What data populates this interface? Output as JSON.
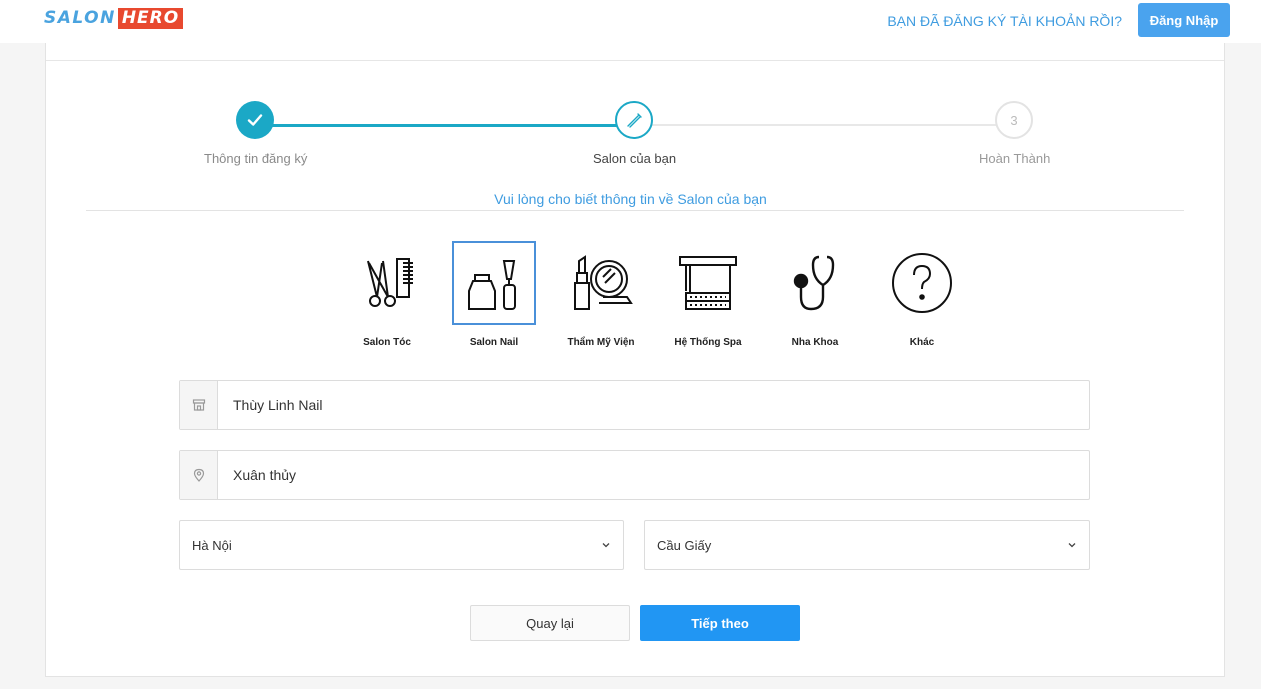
{
  "header": {
    "logo_part1": "SALON",
    "logo_part2": "HERO",
    "already_registered": "BẠN ĐÃ ĐĂNG KÝ TÀI KHOẢN RỒI?",
    "login_label": "Đăng Nhập"
  },
  "steps": [
    {
      "label": "Thông tin đăng ký",
      "state": "done",
      "icon": "check-icon"
    },
    {
      "label": "Salon của bạn",
      "state": "active",
      "icon": "nail-polish-brush-icon"
    },
    {
      "label": "Hoàn Thành",
      "state": "todo",
      "number": "3"
    }
  ],
  "subtitle": "Vui lòng cho biết thông tin về Salon của bạn",
  "categories": [
    {
      "label": "Salon Tóc",
      "icon": "scissors-comb-icon",
      "selected": false
    },
    {
      "label": "Salon Nail",
      "icon": "nail-polish-icon",
      "selected": true
    },
    {
      "label": "Thẩm Mỹ Viện",
      "icon": "lipstick-mirror-icon",
      "selected": false
    },
    {
      "label": "Hệ Thống Spa",
      "icon": "towel-rack-icon",
      "selected": false
    },
    {
      "label": "Nha Khoa",
      "icon": "stethoscope-icon",
      "selected": false
    },
    {
      "label": "Khác",
      "icon": "question-circle-icon",
      "selected": false
    }
  ],
  "form": {
    "salon_name": "Thùy Linh Nail",
    "address": "Xuân thủy",
    "city": "Hà Nội",
    "district": "Cầu Giấy"
  },
  "actions": {
    "back_label": "Quay lại",
    "next_label": "Tiếp theo"
  },
  "colors": {
    "accent": "#1ba8c6",
    "link_blue": "#3f9ce0",
    "primary_button": "#2196f3",
    "logo_red": "#e8492f"
  }
}
